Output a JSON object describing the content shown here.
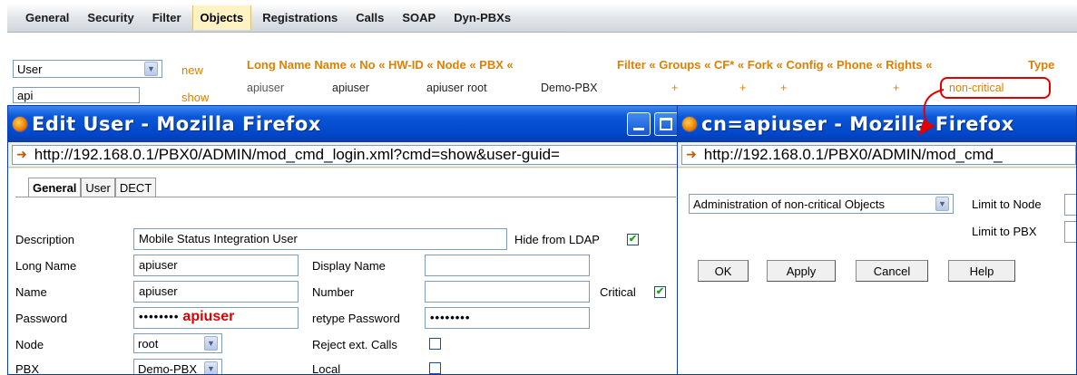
{
  "nav": {
    "tabs": [
      "General",
      "Security",
      "Filter",
      "Objects",
      "Registrations",
      "Calls",
      "SOAP",
      "Dyn-PBXs"
    ],
    "active": "Objects"
  },
  "left": {
    "type_select": "User",
    "new_link": "new",
    "search_value": "api",
    "show_link": "show"
  },
  "objects": {
    "headers": {
      "main": "Long Name Name « No « HW-ID « Node « PBX «",
      "right": "Filter « Groups « CF* « Fork « Config « Phone « Rights «",
      "type": "Type"
    },
    "row": {
      "long_name": "apiuser",
      "name": "apiuser",
      "hw_id": "apiuser",
      "node": "root",
      "pbx": "Demo-PBX",
      "plus": "+",
      "rights": "non-critical"
    }
  },
  "edit_window": {
    "title": "Edit User - Mozilla Firefox",
    "url": "http://192.168.0.1/PBX0/ADMIN/mod_cmd_login.xml?cmd=show&user-guid=",
    "tabs": [
      "General",
      "User",
      "DECT"
    ],
    "active_tab": "General",
    "fields": {
      "description_label": "Description",
      "description_value": "Mobile Status Integration User",
      "hide_ldap_label": "Hide from LDAP",
      "long_name_label": "Long Name",
      "long_name_value": "apiuser",
      "display_name_label": "Display Name",
      "name_label": "Name",
      "name_value": "apiuser",
      "number_label": "Number",
      "critical_label": "Critical",
      "password_label": "Password",
      "password_dots": "••••••••",
      "password_annotation": "apiuser",
      "retype_label": "retype Password",
      "retype_dots": "••••••••",
      "node_label": "Node",
      "node_value": "root",
      "reject_label": "Reject ext. Calls",
      "pbx_label": "PBX",
      "pbx_value": "Demo-PBX",
      "local_label": "Local"
    }
  },
  "rights_window": {
    "title": "cn=apiuser - Mozilla Firefox",
    "url": "http://192.168.0.1/PBX0/ADMIN/mod_cmd_",
    "select_value": "Administration of non-critical Objects",
    "limit_node_label": "Limit to Node",
    "limit_pbx_label": "Limit to PBX",
    "buttons": {
      "ok": "OK",
      "apply": "Apply",
      "cancel": "Cancel",
      "help": "Help"
    }
  },
  "colors": {
    "accent": "#e08000",
    "annotation_red": "#e00000",
    "xp_blue": "#0a56d8"
  }
}
